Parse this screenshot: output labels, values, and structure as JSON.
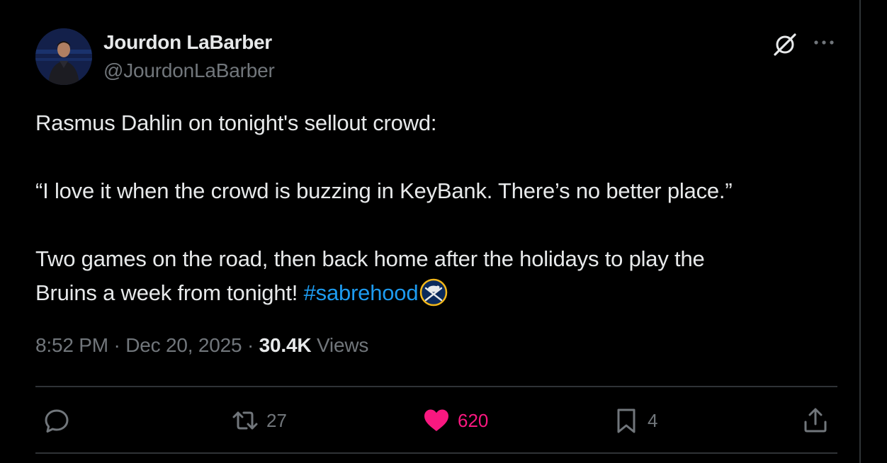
{
  "author": {
    "name": "Jourdon LaBarber",
    "handle": "@JourdonLaBarber"
  },
  "tweet": {
    "line1": "Rasmus Dahlin on tonight's sellout crowd:",
    "line2": "“I love it when the crowd is buzzing in KeyBank. There’s no better place.”",
    "line3": "Two games on the road, then back home after the holidays to play the",
    "line4_text": "Bruins a week from tonight! ",
    "hashtag": "#sabrehood"
  },
  "meta": {
    "time": "8:52 PM",
    "separator1": " · ",
    "date": "Dec 20, 2025",
    "separator2": " · ",
    "views_count": "30.4K",
    "views_label": " Views"
  },
  "actions": {
    "replies": "",
    "reposts": "27",
    "likes": "620",
    "bookmarks": "4"
  },
  "colors": {
    "background": "#000000",
    "text": "#e7e9ea",
    "secondary_text": "#71767b",
    "hashtag": "#1d9bf0",
    "like": "#f91880",
    "divider": "#2f3336"
  },
  "icons": {
    "reply": "reply-icon",
    "repost": "repost-icon",
    "like": "heart-icon",
    "bookmark": "bookmark-icon",
    "share": "share-icon",
    "grok": "grok-icon",
    "more": "more-icon",
    "emoji": "sabres-logo-emoji"
  }
}
